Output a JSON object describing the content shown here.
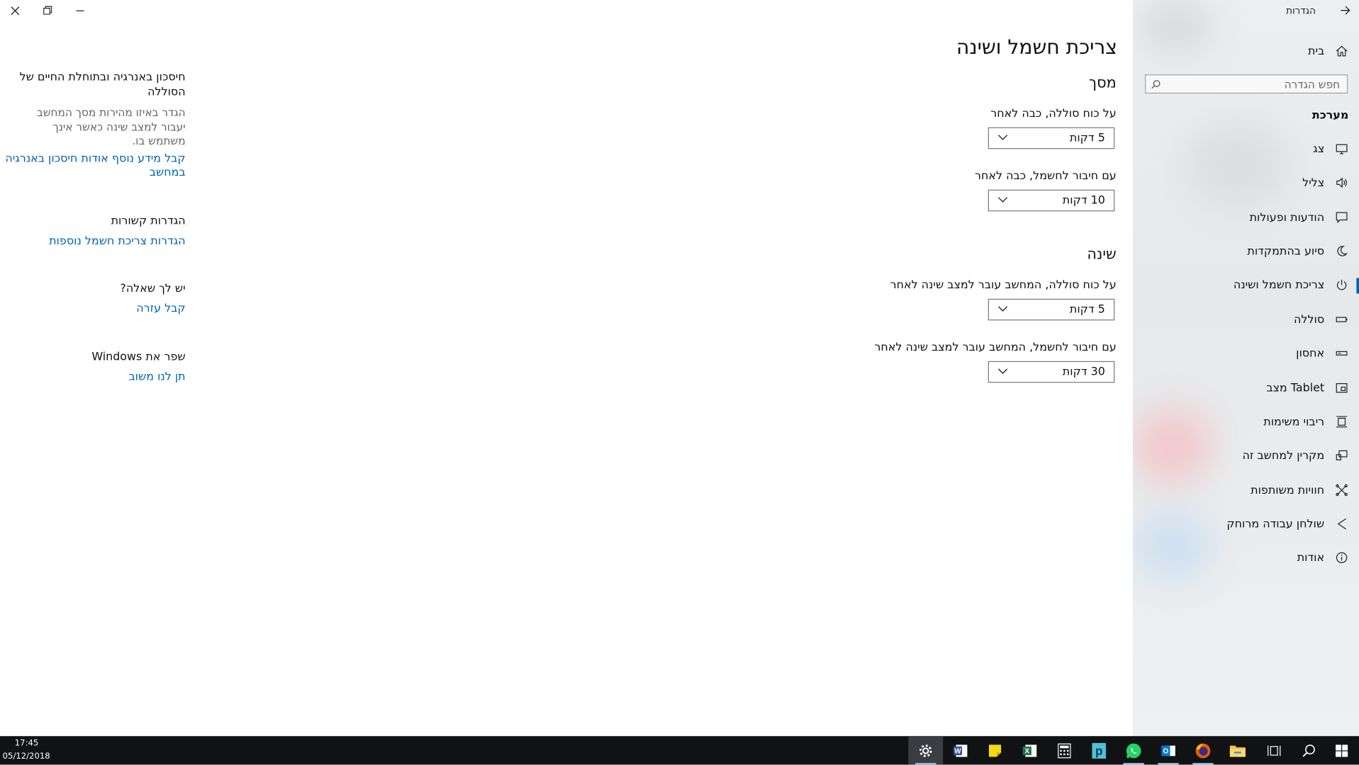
{
  "window": {
    "title": "הגדרות"
  },
  "sidebar": {
    "home_label": "בית",
    "search_placeholder": "חפש הגדרה",
    "section_title": "מערכת",
    "items": [
      {
        "label": "צג",
        "icon": "monitor-icon"
      },
      {
        "label": "צליל",
        "icon": "speaker-icon"
      },
      {
        "label": "הודעות ופעולות",
        "icon": "notification-icon"
      },
      {
        "label": "סיוע בהתמקדות",
        "icon": "moon-icon"
      },
      {
        "label": "צריכת חשמל ושינה",
        "icon": "power-icon",
        "selected": true
      },
      {
        "label": "סוללה",
        "icon": "battery-icon"
      },
      {
        "label": "אחסון",
        "icon": "storage-icon"
      },
      {
        "label": "מצב Tablet",
        "icon": "tablet-icon"
      },
      {
        "label": "ריבוי משימות",
        "icon": "multitasking-icon"
      },
      {
        "label": "מקרין למחשב זה",
        "icon": "projector-icon"
      },
      {
        "label": "חוויות משותפות",
        "icon": "shared-icon"
      },
      {
        "label": "שולחן עבודה מרוחק",
        "icon": "remote-desktop-icon"
      },
      {
        "label": "אודות",
        "icon": "info-icon"
      }
    ],
    "accent_color": "#0063b1"
  },
  "main": {
    "page_title": "צריכת חשמל ושינה",
    "screen": {
      "heading": "מסך",
      "battery_label": "על כוח סוללה, כבה לאחר",
      "battery_value": "5 דקות",
      "plugged_label": "עם חיבור לחשמל, כבה לאחר",
      "plugged_value": "10 דקות"
    },
    "sleep": {
      "heading": "שינה",
      "battery_label": "על כוח סוללה, המחשב עובר למצב שינה לאחר",
      "battery_value": "5 דקות",
      "plugged_label": "עם חיבור לחשמל, המחשב עובר למצב שינה לאחר",
      "plugged_value": "30 דקות"
    }
  },
  "info_panel": {
    "battery_title_line1": "חיסכון באנרגיה ובתוחלת החיים של",
    "battery_title_line2": "הסוללה",
    "battery_text_line1": "הגדר באיזו מהירות מסך המחשב",
    "battery_text_line2": "יעבור למצב שינה כאשר אינך",
    "battery_text_line3": "משתמש בו.",
    "battery_link_line1": "קבל מידע נוסף אודות חיסכון באנרגיה",
    "battery_link_line2": "במחשב",
    "related_title": "הגדרות קשורות",
    "related_link": "הגדרות צריכת חשמל נוספות",
    "question_title": "יש לך שאלה?",
    "help_link": "קבל עזרה",
    "improve_title": "שפר את Windows",
    "feedback_link": "תן לנו משוב",
    "link_color": "#0063b1"
  },
  "taskbar": {
    "time": "17:45",
    "date": "05/12/2018",
    "apps": [
      "settings-icon",
      "word-icon",
      "sticky-notes-icon",
      "excel-icon",
      "calculator-icon",
      "publisher-icon",
      "whatsapp-icon",
      "outlook-icon",
      "firefox-icon",
      "file-explorer-icon",
      "task-view-icon",
      "search-icon",
      "start-icon"
    ]
  }
}
